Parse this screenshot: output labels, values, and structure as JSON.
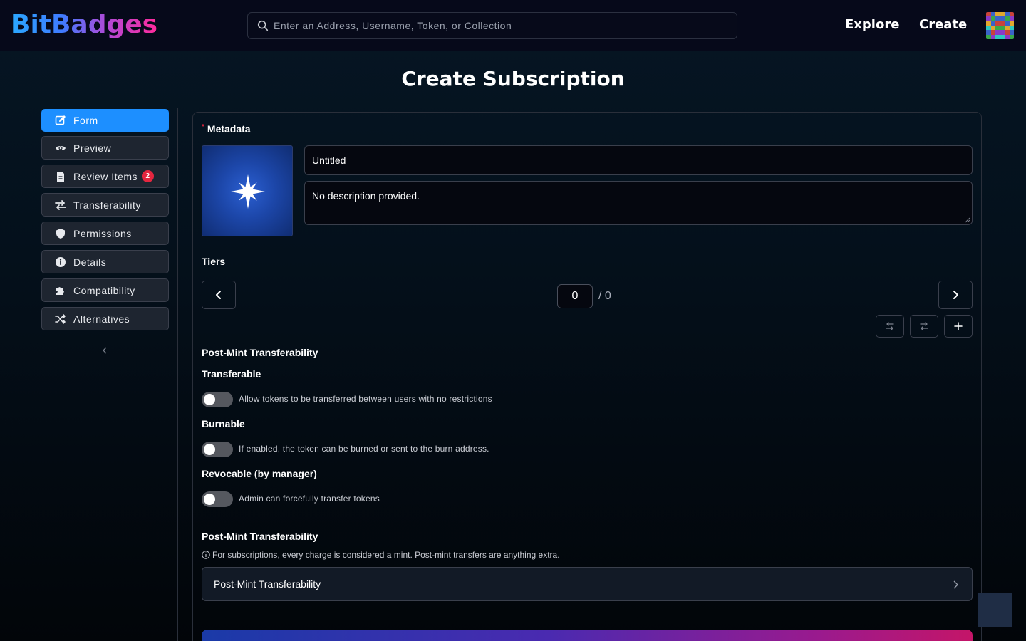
{
  "header": {
    "logo": "BitBadges",
    "search_placeholder": "Enter an Address, Username, Token, or Collection",
    "explore_label": "Explore",
    "create_label": "Create"
  },
  "page_title": "Create Subscription",
  "sidebar": {
    "items": [
      {
        "label": "Form",
        "icon": "edit-icon",
        "active": true
      },
      {
        "label": "Preview",
        "icon": "eye-icon"
      },
      {
        "label": "Review Items",
        "icon": "document-icon",
        "badge": "2"
      },
      {
        "label": "Transferability",
        "icon": "swap-icon"
      },
      {
        "label": "Permissions",
        "icon": "shield-icon"
      },
      {
        "label": "Details",
        "icon": "info-icon"
      },
      {
        "label": "Compatibility",
        "icon": "puzzle-icon"
      },
      {
        "label": "Alternatives",
        "icon": "shuffle-icon"
      }
    ]
  },
  "metadata": {
    "label": "Metadata",
    "name_value": "Untitled",
    "description_value": "No description provided."
  },
  "tiers": {
    "label": "Tiers",
    "current": "0",
    "total": "/ 0"
  },
  "post_mint": {
    "section_label": "Post-Mint Transferability",
    "transferable_label": "Transferable",
    "transferable_desc": "Allow tokens to be transferred between users with no restrictions",
    "burnable_label": "Burnable",
    "burnable_desc": "If enabled, the token can be burned or sent to the burn address.",
    "revocable_label": "Revocable (by manager)",
    "revocable_desc": "Admin can forcefully transfer tokens",
    "section2_label": "Post-Mint Transferability",
    "info_text": "For subscriptions, every charge is considered a mint. Post-mint transfers are anything extra.",
    "panel_label": "Post-Mint Transferability"
  },
  "colors": {
    "accent": "#1d8fff",
    "badge": "#e5263f",
    "background": "#04101b"
  }
}
